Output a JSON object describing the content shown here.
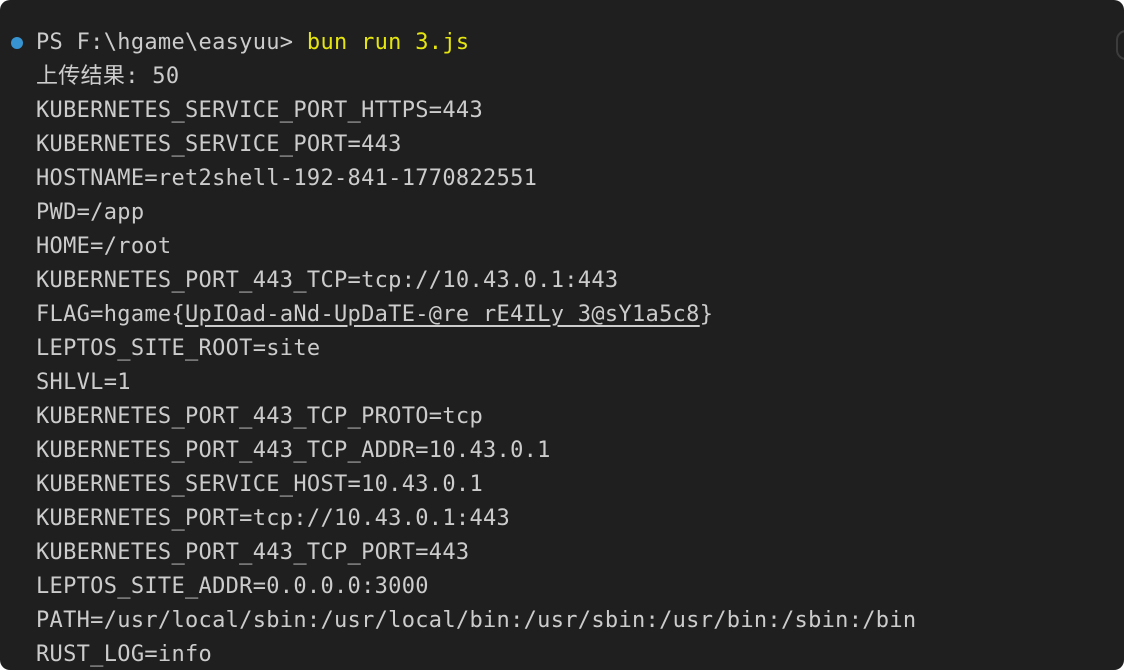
{
  "terminal": {
    "prompt": "PS F:\\hgame\\easyuu> ",
    "command": "bun run 3.js",
    "upload_result": "上传结果: 50",
    "env_lines": [
      "KUBERNETES_SERVICE_PORT_HTTPS=443",
      "KUBERNETES_SERVICE_PORT=443",
      "HOSTNAME=ret2shell-192-841-1770822551",
      "PWD=/app",
      "HOME=/root",
      "KUBERNETES_PORT_443_TCP=tcp://10.43.0.1:443"
    ],
    "flag_prefix": "FLAG=hgame{",
    "flag_link": "UpIOad-aNd-UpDaTE-@re_rE4ILy_3@sY1a5c8",
    "flag_suffix": "}",
    "env_lines_after": [
      "LEPTOS_SITE_ROOT=site",
      "SHLVL=1",
      "KUBERNETES_PORT_443_TCP_PROTO=tcp",
      "KUBERNETES_PORT_443_TCP_ADDR=10.43.0.1",
      "KUBERNETES_SERVICE_HOST=10.43.0.1",
      "KUBERNETES_PORT=tcp://10.43.0.1:443",
      "KUBERNETES_PORT_443_TCP_PORT=443",
      "LEPTOS_SITE_ADDR=0.0.0.0:3000",
      "PATH=/usr/local/sbin:/usr/local/bin:/usr/sbin:/usr/bin:/sbin:/bin",
      "RUST_LOG=info"
    ]
  },
  "colors": {
    "background": "#1f1f1f",
    "text": "#cccccc",
    "command": "#e5e510",
    "status_dot": "#3794d1"
  }
}
